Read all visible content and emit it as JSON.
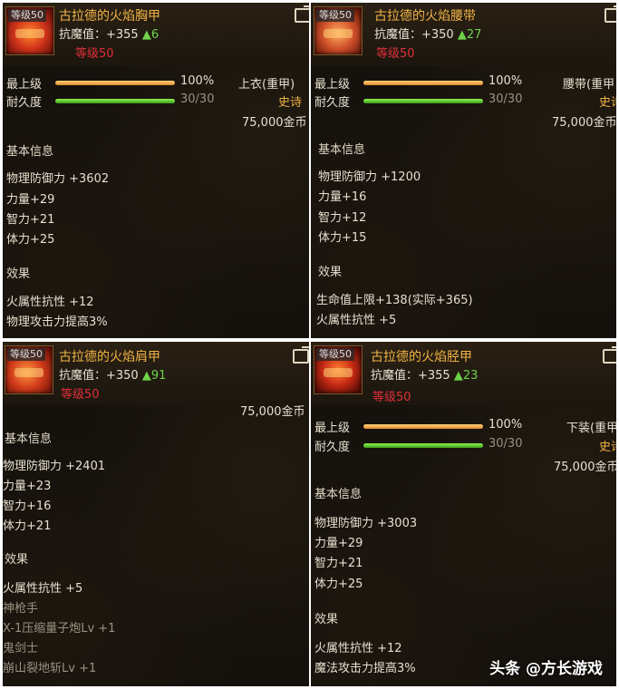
{
  "p1": {
    "level_badge": "等级50",
    "name": "古拉德的火焰胸甲",
    "resist_label": "抗魔值：+355",
    "resist_up": "▲6",
    "req_level": "等级50",
    "grade_label": "最上级",
    "grade_pct": "100%",
    "grade_fill": 1.0,
    "dur_label": "耐久度",
    "dur_val": "30/30",
    "dur_fill": 1.0,
    "slot": "上衣(重甲)",
    "rarity": "史诗",
    "price": "75,000金币",
    "basic_title": "基本信息",
    "basic": [
      "物理防御力 +3602",
      "力量+29",
      "智力+21",
      "体力+25"
    ],
    "effect_title": "效果",
    "effects": [
      "火属性抗性 +12",
      "物理攻击力提高3%"
    ]
  },
  "p2": {
    "level_badge": "等级50",
    "name": "古拉德的火焰腰带",
    "resist_label": "抗魔值：+350",
    "resist_up": "▲27",
    "req_level": "等级50",
    "grade_label": "最上级",
    "grade_pct": "100%",
    "grade_fill": 1.0,
    "dur_label": "耐久度",
    "dur_val": "30/30",
    "dur_fill": 1.0,
    "slot": "腰带(重甲",
    "rarity": "史诗",
    "price": "75,000金币",
    "basic_title": "基本信息",
    "basic": [
      "物理防御力 +1200",
      "力量+16",
      "智力+12",
      "体力+15"
    ],
    "effect_title": "效果",
    "effects": [
      "生命值上限+138(实际+365)",
      "火属性抗性 +5"
    ]
  },
  "p3": {
    "level_badge": "等级50",
    "name": "古拉德的火焰肩甲",
    "resist_label": "抗魔值：+350",
    "resist_up": "▲91",
    "req_level": "等级50",
    "price": "75,000金币",
    "basic_title": "基本信息",
    "basic": [
      "物理防御力 +2401",
      "力量+23",
      "智力+16",
      "体力+21"
    ],
    "effect_title": "效果",
    "effects": [
      "火属性抗性 +5",
      "神枪手",
      "X-1压缩量子炮Lv +1",
      "鬼剑士",
      "崩山裂地斩Lv +1"
    ]
  },
  "p4": {
    "level_badge": "等级50",
    "name": "古拉德的火焰胫甲",
    "resist_label": "抗魔值：+355",
    "resist_up": "▲23",
    "req_level": "等级50",
    "grade_label": "最上级",
    "grade_pct": "100%",
    "grade_fill": 1.0,
    "dur_label": "耐久度",
    "dur_val": "30/30",
    "dur_fill": 1.0,
    "slot": "下装(重甲",
    "rarity": "史诗",
    "price": "75,000金币",
    "basic_title": "基本信息",
    "basic": [
      "物理防御力 +3003",
      "力量+29",
      "智力+21",
      "体力+25"
    ],
    "effect_title": "效果",
    "effects": [
      "火属性抗性 +12",
      "魔法攻击力提高3%"
    ]
  },
  "watermark": "头条 @方长游戏",
  "colors": {
    "name": "#f0b445",
    "required_level": "#e0303a",
    "up_arrow": "#6fd24a",
    "rarity": "#f0b445"
  }
}
